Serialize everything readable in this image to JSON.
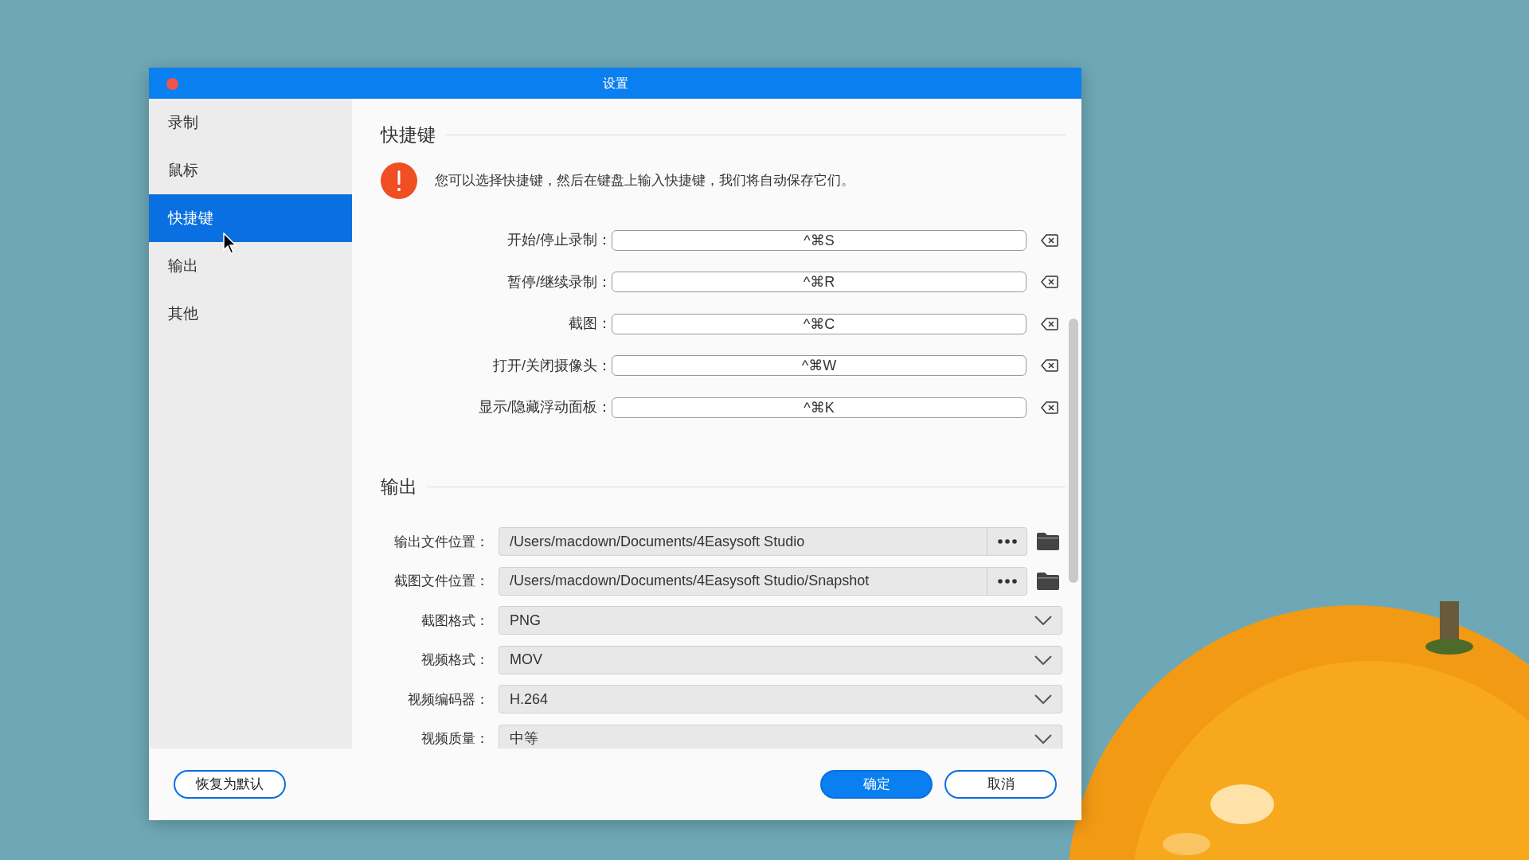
{
  "window": {
    "title": "设置"
  },
  "sidebar": {
    "items": [
      {
        "label": "录制",
        "selected": false
      },
      {
        "label": "鼠标",
        "selected": false
      },
      {
        "label": "快捷键",
        "selected": true
      },
      {
        "label": "输出",
        "selected": false
      },
      {
        "label": "其他",
        "selected": false
      }
    ]
  },
  "shortcuts": {
    "title": "快捷键",
    "notice": "您可以选择快捷键，然后在键盘上输入快捷键，我们将自动保存它们。",
    "items": [
      {
        "label": "开始/停止录制：",
        "value": "^⌘S"
      },
      {
        "label": "暂停/继续录制：",
        "value": "^⌘R"
      },
      {
        "label": "截图：",
        "value": "^⌘C"
      },
      {
        "label": "打开/关闭摄像头：",
        "value": "^⌘W"
      },
      {
        "label": "显示/隐藏浮动面板：",
        "value": "^⌘K"
      }
    ]
  },
  "output": {
    "title": "输出",
    "paths": [
      {
        "label": "输出文件位置：",
        "value": "/Users/macdown/Documents/4Easysoft Studio"
      },
      {
        "label": "截图文件位置：",
        "value": "/Users/macdown/Documents/4Easysoft Studio/Snapshot"
      }
    ],
    "selects": [
      {
        "label": "截图格式：",
        "value": "PNG"
      },
      {
        "label": "视频格式：",
        "value": "MOV"
      },
      {
        "label": "视频编码器：",
        "value": "H.264"
      },
      {
        "label": "视频质量：",
        "value": "中等"
      }
    ]
  },
  "buttons": [
    {
      "label": "恢复为默认",
      "kind": "outline"
    },
    {
      "label": "确定",
      "kind": "primary"
    },
    {
      "label": "取消",
      "kind": "outline"
    }
  ]
}
